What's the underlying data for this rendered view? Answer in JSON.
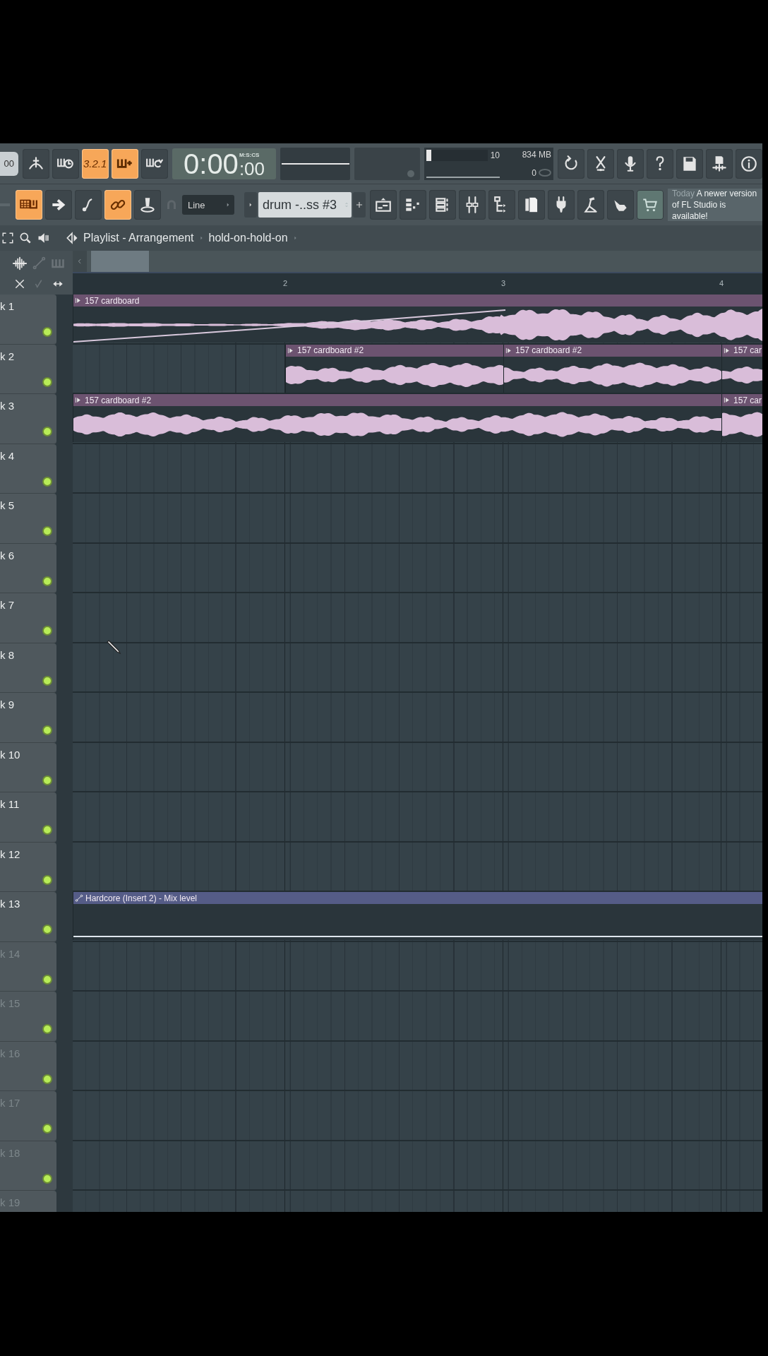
{
  "toolbar": {
    "tempo": "00",
    "transport_buttons": [
      {
        "kind": "metronome",
        "on": false
      },
      {
        "kind": "wait",
        "on": false
      },
      {
        "kind": "countdown",
        "label": "3.2.1",
        "on": true
      },
      {
        "kind": "blend",
        "on": true
      },
      {
        "kind": "loop-record",
        "on": false
      }
    ],
    "time": {
      "main": "0:00",
      "fraction": ":00",
      "format": "M:S:CS"
    },
    "cpu_meter": {
      "level": 0.08,
      "polyphony": "10"
    },
    "memory": "834 MB",
    "voices": "0",
    "tool_buttons": [
      {
        "kind": "refresh"
      },
      {
        "kind": "scissors"
      },
      {
        "kind": "microphone"
      },
      {
        "kind": "help"
      },
      {
        "kind": "save"
      },
      {
        "kind": "save-audio"
      },
      {
        "kind": "info"
      }
    ],
    "edit_buttons": [
      {
        "kind": "piano-roll",
        "on": true
      },
      {
        "kind": "arrow",
        "on": false
      },
      {
        "kind": "slide",
        "on": false
      },
      {
        "kind": "link",
        "on": true
      },
      {
        "kind": "stamp",
        "on": false
      }
    ],
    "snap": {
      "value": "Line"
    },
    "pattern": {
      "value": "drum -..ss #3"
    },
    "window_buttons": [
      {
        "kind": "playlist"
      },
      {
        "kind": "step-sequencer"
      },
      {
        "kind": "channel-rack"
      },
      {
        "kind": "mixer"
      },
      {
        "kind": "browser"
      },
      {
        "kind": "file"
      },
      {
        "kind": "plugin"
      },
      {
        "kind": "pedal"
      },
      {
        "kind": "hand"
      },
      {
        "kind": "cart"
      }
    ],
    "news": {
      "date": "Today",
      "message": "A newer version of FL Studio is available!"
    }
  },
  "playlist": {
    "title": "Playlist - Arrangement",
    "arrangement": "hold-on-hold-on",
    "ruler": [
      "2",
      "3",
      "4"
    ],
    "tracks": [
      {
        "name": "k 1",
        "dimmed": false,
        "active": true,
        "clips": [
          {
            "kind": "audio",
            "label": "157 cardboard"
          }
        ]
      },
      {
        "name": "k 2",
        "dimmed": false,
        "active": true,
        "clips": [
          {
            "kind": "audio",
            "label": "157 cardboard #2"
          },
          {
            "kind": "audio",
            "label": "157 cardboard #2"
          },
          {
            "kind": "audio",
            "label": "157 car"
          }
        ]
      },
      {
        "name": "k 3",
        "dimmed": false,
        "active": true,
        "clips": [
          {
            "kind": "audio",
            "label": "157 cardboard #2"
          },
          {
            "kind": "audio",
            "label": "157 car"
          }
        ]
      },
      {
        "name": "k 4",
        "dimmed": false,
        "active": true
      },
      {
        "name": "k 5",
        "dimmed": false,
        "active": true
      },
      {
        "name": "k 6",
        "dimmed": false,
        "active": true
      },
      {
        "name": "k 7",
        "dimmed": false,
        "active": true
      },
      {
        "name": "k 8",
        "dimmed": false,
        "active": true
      },
      {
        "name": "k 9",
        "dimmed": false,
        "active": true
      },
      {
        "name": "k 10",
        "dimmed": false,
        "active": true
      },
      {
        "name": "k 11",
        "dimmed": false,
        "active": true
      },
      {
        "name": "k 12",
        "dimmed": false,
        "active": true
      },
      {
        "name": "k 13",
        "dimmed": false,
        "active": true,
        "clips": [
          {
            "kind": "automation",
            "label": "Hardcore (Insert 2) - Mix level"
          }
        ]
      },
      {
        "name": "k 14",
        "dimmed": true,
        "active": true
      },
      {
        "name": "k 15",
        "dimmed": true,
        "active": true
      },
      {
        "name": "k 16",
        "dimmed": true,
        "active": true
      },
      {
        "name": "k 17",
        "dimmed": true,
        "active": true
      },
      {
        "name": "k 18",
        "dimmed": true,
        "active": true
      },
      {
        "name": "k 19",
        "dimmed": true
      }
    ]
  }
}
